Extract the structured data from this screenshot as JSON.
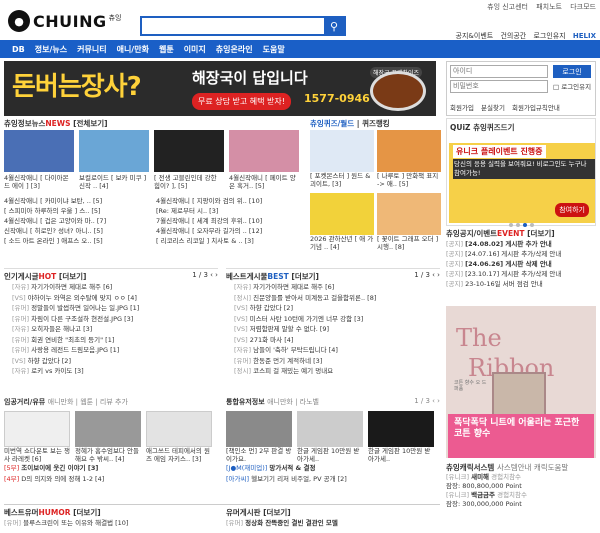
{
  "top_links": [
    "츄잉 신고센터",
    "패치노트",
    "다크모드"
  ],
  "logo": {
    "text": "CHUING",
    "sub": "츄잉"
  },
  "search": {
    "placeholder": "",
    "button": "⚲"
  },
  "util_links": [
    "공지&이벤트",
    "건의공간",
    "로그인유지",
    "HELIX"
  ],
  "nav": [
    "DB",
    "정보/뉴스",
    "커뮤니티",
    "애니/만화",
    "웹툰",
    "이미지",
    "츄잉온라인",
    "도움말"
  ],
  "banner": {
    "big": "돈버는장사?",
    "mid": "해장국이 답입니다",
    "pill": "무료 상담 받고 혜택 받자!",
    "phone": "1577-0946",
    "brand": "해장국 프랜차이즈"
  },
  "login": {
    "id_placeholder": "아이디",
    "pw_placeholder": "비밀번호",
    "login_button": "로그인",
    "keep": "로그인유지",
    "links": [
      "회원가입",
      "분실찾기",
      "회원가입규칙안내"
    ]
  },
  "news": {
    "title": "츄잉정보뉴스",
    "tag": "NEWS",
    "all": "[전체보기]",
    "thumbs": [
      {
        "cap": "4월신작애니 [ 다이아몬드 에이 ] [3]",
        "color": "#4a6fb5"
      },
      {
        "cap": "보컬로이드 [ 보카 미쿠 ] 신작 .. [4]",
        "color": "#6aa6d6"
      },
      {
        "cap": "[ 전생 고블린인데 강한 힘이? ], [5]",
        "color": "#222222"
      },
      {
        "cap": "4월신작애니 [ 페이트 양은 혹거.. [5]",
        "color": "#d48fa6"
      }
    ],
    "rows": [
      [
        "4월신작애니 [ 카미이냐 보탄, .. [5]",
        "4월신작애니 [ 지팡이와 검의 위.. [10]"
      ],
      [
        "[ 스피미아 하루하의 우울 ] 스.. [5]",
        "[Re: 제로부터 시.. [3]"
      ],
      [
        "4월신작애니 [ 겁은 고양이와 마.. [7]",
        "7월신작애니 [ 세계 최강의 후위.. [10]"
      ],
      [
        "신작애니 [ 히로인? 성녀? 아니.. [5]",
        "4월신작애니 [ 오자무라 길가의 .. [12]"
      ],
      [
        "[ 소드 아트 온라인 ] 애프스 오.. [5]",
        "[ 리코리스 리코일 ] 치사토 & .. [3]"
      ]
    ]
  },
  "quiz": {
    "title": "츄잉퀴즈/월드",
    "tab": "퀴즈랭킹",
    "items": [
      {
        "cap": "[ 포켓몬스터 ] 원드 & 괴이트, [3]",
        "color": "#dfe9f5"
      },
      {
        "cap": "[ 나루토 ] 만화책 표지 -> 애.. [5]",
        "color": "#e59545"
      },
      {
        "cap": "2026 관하산년 [ 애 가 기념 .. [4]",
        "color": "#f2d23a"
      },
      {
        "cap": "[ 꽃이트 그래프 오더 ] 시행.. [8]",
        "color": "#efb877"
      }
    ]
  },
  "side_quiz": {
    "title": "QUiZ 츄잉퀴즈드기",
    "img_title": "유니크 플레이벤트 진행중",
    "img_sub": "당신의 응용 실력을 보여줘요! 비로그인도 누구나 참여가능!",
    "go": "참여하기"
  },
  "notice": {
    "title": "츄잉공지/이벤트",
    "tag": "EVENT",
    "all": "[더보기]",
    "rows": [
      [
        "[공지]",
        "[24.08.02] 게시판 추가 안내"
      ],
      [
        "[공지]",
        "[24.07.16] 게시판 추가/삭제 안내"
      ],
      [
        "[공지]",
        "[24.06.26] 게시판 삭제 안내"
      ],
      [
        "[공지]",
        "[23.10.17] 게시판 추가/삭제 안내"
      ],
      [
        "[공지]",
        "23-10-16일 서버 점검 안내"
      ]
    ]
  },
  "hot_board": {
    "title": "인기게시글",
    "tag": "HOT",
    "all": "[더보기]",
    "page": "1 / 3",
    "rows": [
      [
        "[자유]",
        "자기가이하면 제대로 해주 [6]"
      ],
      [
        "[VS]",
        "야하이누 와역은 외수탈에 맞지 ㅇㅇ [4]"
      ],
      [
        "[유머]",
        "정말들이 발썹하면 일어나는 일.JPG [1]"
      ],
      [
        "[유머]",
        "차림이 다른 구조설하 현전설.JPG [3]"
      ],
      [
        "[자유]",
        "오히자들은 해나고 [3]"
      ],
      [
        "[유머]",
        "회권 연비한 \"최초의 등기\" [1]"
      ],
      [
        "[유머]",
        "사랑용 레전드 드림모음.JPG [1]"
      ],
      [
        "[VS]",
        "하향 갑았다 [2]"
      ],
      [
        "[자유]",
        "로키 vs 카이도 [3]"
      ]
    ]
  },
  "best_board": {
    "title": "베스트게시물",
    "tag": "BEST",
    "all": "[더보기]",
    "page": "1 / 3",
    "rows": [
      [
        "[자유]",
        "자기가이하면 제대로 해주 [6]"
      ],
      [
        "[정시]",
        "진문양들를 받아서 미계동고 걸을함위론.. [8]"
      ],
      [
        "[VS]",
        "하향 갑았다 [2]"
      ],
      [
        "[VS]",
        "미스터 사탄 10턴에 가기엔 너무 강함 [3]"
      ],
      [
        "[VS]",
        "저렴함판제 말할 수 없다. [9]"
      ],
      [
        "[VS]",
        "271화 마사 [4]"
      ],
      [
        "[자유]",
        "남들이 '축하' 부탁드립니다 [4]"
      ],
      [
        "[유머]",
        "한동준 먼기 계적하네 [3]"
      ],
      [
        "[정시]",
        "코스피 걸 재밌는 예기 멍내요"
      ]
    ]
  },
  "image_board": {
    "title": "임공거리/유뮤",
    "sub": "애니만화 | 웹툰 | 리뷰 추가",
    "thumbs": [
      {
        "cap": "미번역 쇼다운토 보는 쟁사 라레켓 [6]",
        "color": "#efefef"
      },
      {
        "cap": "정혜가 홈수엄보다 안들해요 수 밖씨.. [4]",
        "color": "#999999"
      },
      {
        "cap": "애그쓰드 테피에서의 원즈 에임 자키스.. [3]",
        "color": "#e3e3e3"
      }
    ],
    "lines": [
      [
        "[5부]",
        "조이보이에 웃긴 이야기 [3]"
      ],
      [
        "[4부]",
        "D의 의지와 의에 정해 1-2 [4]"
      ]
    ]
  },
  "pic_board": {
    "title": "통합유저정보",
    "sub": "애니만화 | 라노벨",
    "page": "1 / 3",
    "thumbs": [
      {
        "cap": "[책인소 먼] 2부 판결 방이가요.",
        "color": "#8a8a8a"
      },
      {
        "cap": "한글 게임판 10만원 받아가세..",
        "color": "#cccccc"
      },
      {
        "cap": "한글 게임판 10만원 받아가세..",
        "color": "#1a1a1a"
      }
    ],
    "lines": [
      [
        "[J●M(재미업)]",
        "망가서적 & 결정"
      ],
      [
        "[아가씨]",
        "헬보기기 리저 비주얼, PV 공개 [2]"
      ]
    ]
  },
  "best_humor": {
    "title": "베스트유머",
    "tag": "HUMOR",
    "all": "[더보기]",
    "row": [
      "[유머]",
      "블루스크린이 또는 이유와 해결법 [10]"
    ]
  },
  "anime_board": {
    "title": "유머게시판",
    "all": "[더보기]",
    "row": [
      "[유머]",
      "정상화 잔뜩중인 결빈 결관인 모델"
    ]
  },
  "ad": {
    "t1": "The",
    "t2": "Ribbon",
    "box": "폭닥폭닥 니트에 어울리는 포근한 코튼 향수",
    "small": "코튼 향수 오 드 퍼퓸"
  },
  "ranking": {
    "title": "츄잉캐릭서스템",
    "sub": "사스템안내 캐릭도움말",
    "rows": [
      [
        "[유니크]",
        "새미해",
        "경험치참수",
        "잠장: 800,800,000 Point"
      ],
      [
        "[유니크]",
        "백금금주",
        "경험치참수",
        "잠장: 300,000,000 Point"
      ]
    ]
  }
}
